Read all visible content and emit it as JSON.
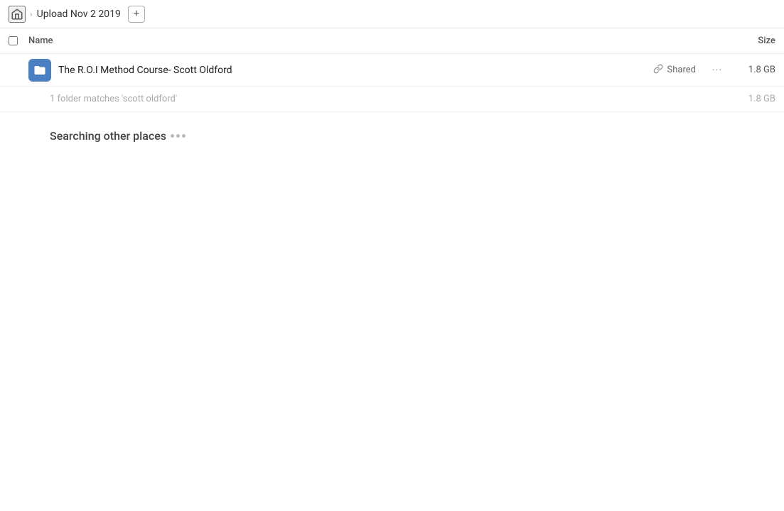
{
  "header": {
    "home_label": "Home",
    "breadcrumb_label": "Upload Nov 2 2019",
    "add_button_label": "+"
  },
  "columns": {
    "name_label": "Name",
    "size_label": "Size"
  },
  "file_row": {
    "icon_color": "#4a7fc1",
    "file_name": "The R.O.I Method Course- Scott Oldford",
    "shared_label": "Shared",
    "more_label": "···",
    "file_size": "1.8 GB"
  },
  "summary": {
    "text": "1 folder matches 'scott oldford'",
    "size": "1.8 GB"
  },
  "searching": {
    "label": "Searching other places"
  },
  "icons": {
    "home": "🏠",
    "link": "🔗",
    "folder_color": "#4a7fc1"
  }
}
